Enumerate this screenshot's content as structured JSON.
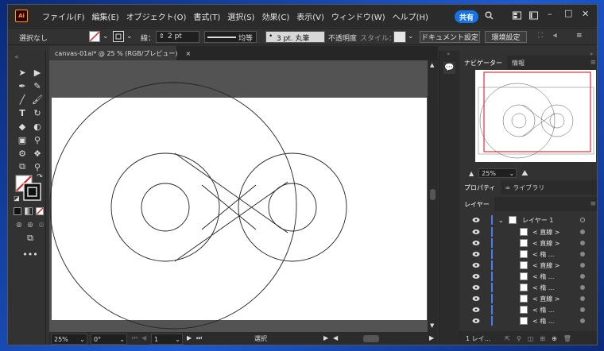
{
  "app": {
    "logo": "Ai",
    "share_label": "共有"
  },
  "menu": [
    "ファイル(F)",
    "編集(E)",
    "オブジェクト(O)",
    "書式(T)",
    "選択(S)",
    "効果(C)",
    "表示(V)",
    "ウィンドウ(W)",
    "ヘルプ(H)"
  ],
  "control_bar": {
    "selection": "選択なし",
    "stroke_label": "線：",
    "stroke_weight": "2 pt",
    "profile": "均等",
    "brush": "3 pt. 丸筆",
    "opacity_label": "不透明度",
    "style_label": "スタイル：",
    "doc_settings": "ドキュメント設定",
    "prefs": "環境設定"
  },
  "document": {
    "tab_title": "canvas-01ai* @ 25 % (RGB/プレビュー)",
    "close": "×"
  },
  "status_bar": {
    "zoom": "25%",
    "angle": "0°",
    "artboard": "1",
    "tool": "選択"
  },
  "navigator": {
    "tab": "ナビゲーター",
    "info_tab": "情報",
    "zoom": "25%"
  },
  "properties": {
    "tab": "プロパティ",
    "libraries_tab": "ライブラリ"
  },
  "layers": {
    "tab": "レイヤー",
    "layer_name": "レイヤー 1",
    "items": [
      "< 直線 >",
      "< 直線 >",
      "< 楕 ...",
      "< 直線 >",
      "< 楕 ...",
      "< 楕 ...",
      "< 直線 >",
      "< 楕 ...",
      "< 楕 ..."
    ],
    "footer": "1 レイ..."
  },
  "colors": {
    "accent": "#1473e6",
    "layer_blue": "#4a7cf0",
    "nav_frame": "#e0303a"
  }
}
